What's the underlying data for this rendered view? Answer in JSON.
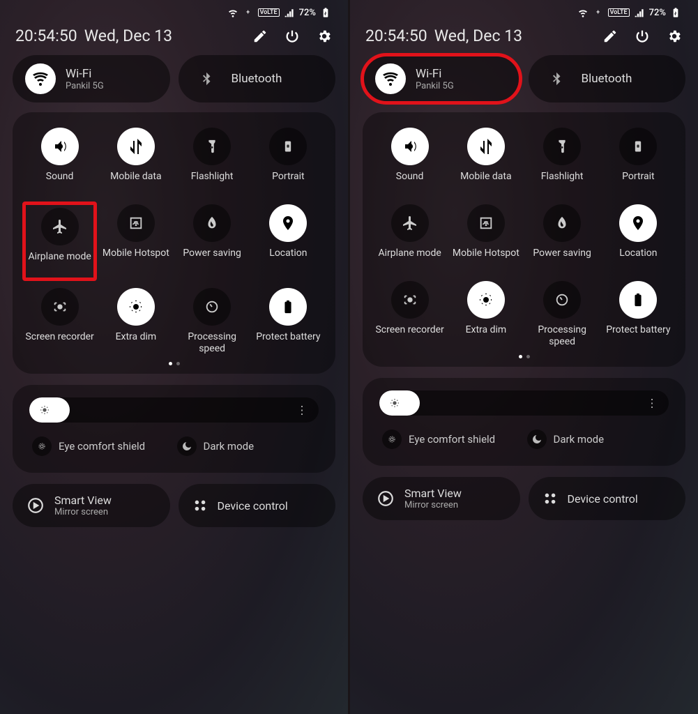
{
  "status": {
    "volte": "VoLTE",
    "battery": "72%"
  },
  "header": {
    "time": "20:54:50",
    "date": "Wed, Dec 13"
  },
  "pills": {
    "wifi": {
      "title": "Wi-Fi",
      "subtitle": "Pankil 5G"
    },
    "bt": {
      "title": "Bluetooth"
    }
  },
  "tiles": {
    "sound": "Sound",
    "mdata": "Mobile data",
    "flash": "Flashlight",
    "portrait": "Portrait",
    "airplane": "Airplane mode",
    "hotspot": "Mobile Hotspot",
    "psave": "Power saving",
    "location": "Location",
    "recorder": "Screen recorder",
    "extradim": "Extra dim",
    "procspeed": "Processing speed",
    "protbatt": "Protect battery"
  },
  "brightness": {
    "eye": "Eye comfort shield",
    "dark": "Dark mode"
  },
  "bottom": {
    "smartview": {
      "title": "Smart View",
      "sub": "Mirror screen"
    },
    "devctrl": {
      "title": "Device control"
    }
  },
  "slider_percent": 14
}
